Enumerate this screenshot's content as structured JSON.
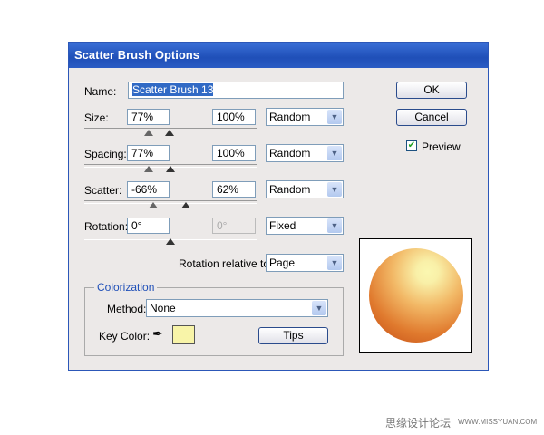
{
  "dialog": {
    "title": "Scatter Brush Options"
  },
  "name": {
    "label": "Name:",
    "value": "Scatter Brush 13"
  },
  "rows": [
    {
      "label": "Size:",
      "min": "77%",
      "max": "100%",
      "mode": "Random"
    },
    {
      "label": "Spacing:",
      "min": "77%",
      "max": "100%",
      "mode": "Random"
    },
    {
      "label": "Scatter:",
      "min": "-66%",
      "max": "62%",
      "mode": "Random"
    },
    {
      "label": "Rotation:",
      "min": "0°",
      "max": "0°",
      "mode": "Fixed"
    }
  ],
  "rotation_relative": {
    "label": "Rotation relative to:",
    "value": "Page"
  },
  "colorization": {
    "title": "Colorization",
    "method_label": "Method:",
    "method": "None",
    "key_color_label": "Key Color:",
    "key_color": "#f8f4a8",
    "tips": "Tips"
  },
  "buttons": {
    "ok": "OK",
    "cancel": "Cancel"
  },
  "preview": {
    "label": "Preview",
    "checked": true
  },
  "watermark": {
    "cn": "思缘设计论坛",
    "url": "WWW.MISSYUAN.COM"
  }
}
